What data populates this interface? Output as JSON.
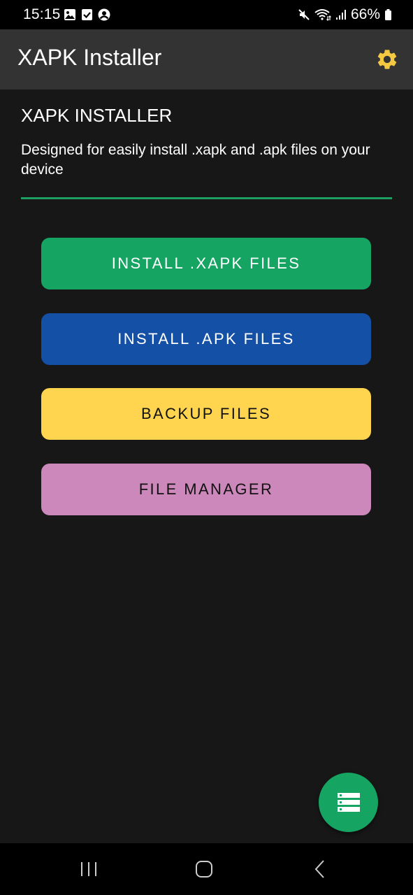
{
  "status_bar": {
    "time": "15:15",
    "left_icons": [
      "gallery-icon",
      "checkbox-icon",
      "account-icon"
    ],
    "right_icons": [
      "mute-icon",
      "wifi-icon",
      "signal-icon",
      "battery-icon"
    ],
    "battery_percent": "66%"
  },
  "app_bar": {
    "title": "XAPK Installer",
    "settings_icon": "gear-icon",
    "settings_color": "#f5c842"
  },
  "main": {
    "heading": "XAPK INSTALLER",
    "description": "Designed for easily install .xapk and .apk files on your device",
    "divider_color": "#1e9e63",
    "buttons": [
      {
        "label": "INSTALL .XAPK FILES",
        "bg": "#16a463",
        "fg": "#ffffff"
      },
      {
        "label": "INSTALL .APK FILES",
        "bg": "#1450a6",
        "fg": "#ffffff"
      },
      {
        "label": "BACKUP FILES",
        "bg": "#ffd54f",
        "fg": "#111111"
      },
      {
        "label": "FILE MANAGER",
        "bg": "#cc88bb",
        "fg": "#111111"
      }
    ]
  },
  "fab": {
    "icon": "list-icon",
    "color": "#16a463"
  },
  "nav_bar": {
    "buttons": [
      "recent-apps",
      "home",
      "back"
    ]
  }
}
